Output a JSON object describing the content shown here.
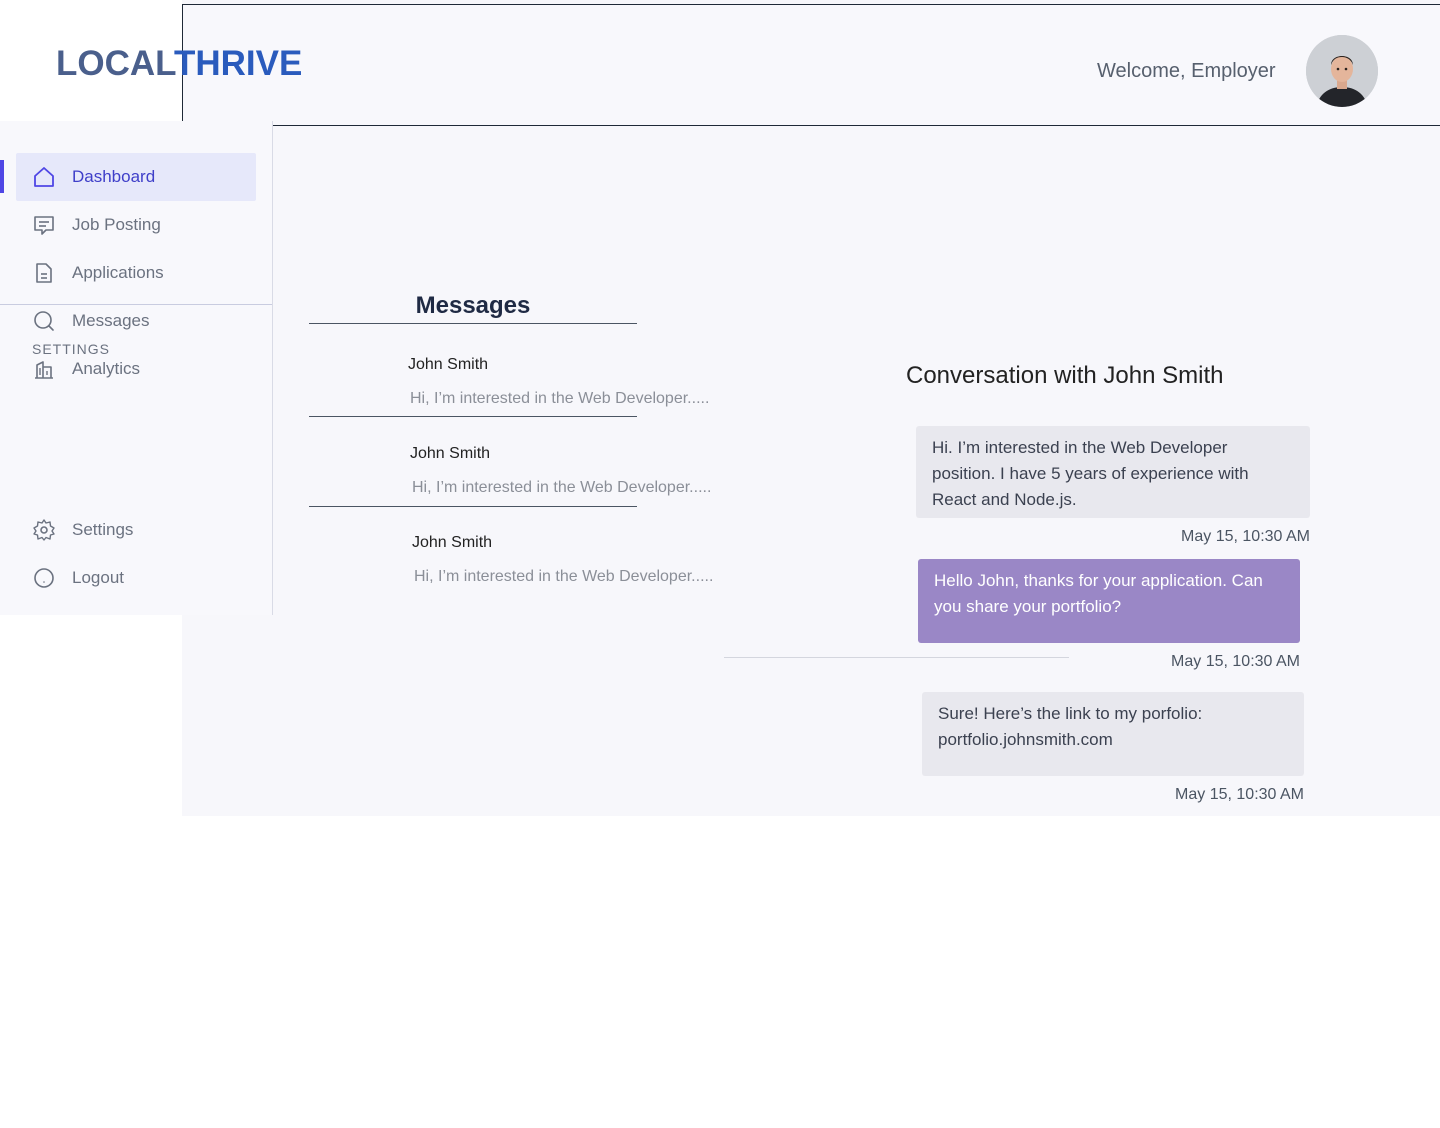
{
  "brand": {
    "part1": "LOCAL",
    "part2": "THRIVE"
  },
  "header": {
    "welcome": "Welcome, Employer"
  },
  "sidebar": {
    "items": [
      {
        "label": "Dashboard",
        "icon": "home-icon"
      },
      {
        "label": "Job Posting",
        "icon": "chat-icon"
      },
      {
        "label": "Applications",
        "icon": "document-icon"
      },
      {
        "label": "Messages",
        "icon": "search-icon"
      },
      {
        "label": "Analytics",
        "icon": "building-icon"
      }
    ],
    "settings_heading": "SETTINGS",
    "settings_items": [
      {
        "label": "Settings",
        "icon": "gear-icon"
      },
      {
        "label": "Logout",
        "icon": "logout-icon"
      }
    ]
  },
  "messages": {
    "title": "Messages",
    "conversations": [
      {
        "name": "John Smith",
        "preview": "Hi, I’m interested in the Web Developer....."
      },
      {
        "name": "John Smith",
        "preview": "Hi, I’m interested in the Web Developer....."
      },
      {
        "name": "John Smith",
        "preview": "Hi, I’m interested in the Web Developer....."
      }
    ]
  },
  "conversation": {
    "title": "Conversation with John Smith",
    "messages": [
      {
        "text": "Hi. I’m interested in the Web Developer position. I have 5 years of experience with React and Node.js.",
        "time": "May 15, 10:30 AM"
      },
      {
        "text": "Hello John, thanks for your application. Can you share your portfolio?",
        "time": "May 15, 10:30 AM"
      },
      {
        "text": "Sure! Here’s the link to my porfolio: portfolio.johnsmith.com",
        "time": "May 15, 10:30 AM"
      }
    ]
  },
  "colors": {
    "brand_dark": "#4a5f8c",
    "brand_blue": "#2a5bbd",
    "accent": "#4f46e5",
    "outgoing_bubble": "#9a87c6"
  }
}
